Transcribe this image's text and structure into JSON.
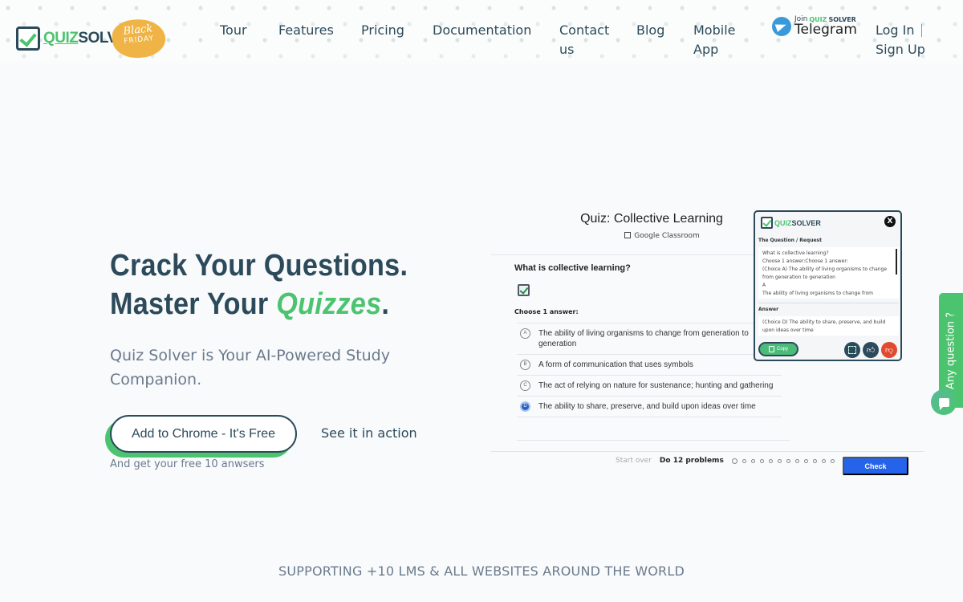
{
  "header": {
    "logo": {
      "part1": "QUIZ",
      "part2": "SOLVER"
    },
    "promo_badge": {
      "line1": "Black",
      "line2": "FRIDAY"
    },
    "nav": [
      {
        "label": "Tour"
      },
      {
        "label": "Features"
      },
      {
        "label": "Pricing"
      },
      {
        "label": "Documentation"
      },
      {
        "label": "Contact us"
      },
      {
        "label": "Blog"
      },
      {
        "label": "Mobile App"
      }
    ],
    "telegram": {
      "join": "Join",
      "brand1": "QUIZ",
      "brand2": "SOLVER",
      "label": "Telegram"
    },
    "auth": {
      "login": "Log In",
      "signup": "Sign Up"
    }
  },
  "hero": {
    "title_line1": "Crack Your Questions.",
    "title_line2_prefix": "Master Your ",
    "title_line2_accent": "Quizzes",
    "title_line2_suffix": ".",
    "subtitle": "Quiz Solver is Your AI-Powered Study Companion.",
    "cta_label": "Add to Chrome - It's Free",
    "secondary_link": "See it in action",
    "note": "And get your free 10 anwsers"
  },
  "quiz_demo": {
    "title": "Quiz: Collective Learning",
    "source": "Google Classroom",
    "question": "What is collective learning?",
    "instruction": "Choose 1 answer:",
    "choices": [
      {
        "letter": "A",
        "text": "The ability of living organisms to change from generation to generation",
        "selected": false
      },
      {
        "letter": "B",
        "text": "A form of communication that uses symbols",
        "selected": false
      },
      {
        "letter": "C",
        "text": "The act of relying on nature for sustenance; hunting and gathering",
        "selected": false
      },
      {
        "letter": "D",
        "text": "The ability to share, preserve, and build upon ideas over time",
        "selected": true
      }
    ],
    "footer": {
      "start_over": "Start over",
      "problems": "Do 12 problems",
      "progress_total": 12,
      "progress_current": 1,
      "check": "Check"
    }
  },
  "popup": {
    "logo": {
      "part1": "QUIZ",
      "part2": "SOLVER"
    },
    "close": "X",
    "question_label": "The Question / Request",
    "question_text": "What is collective learning?\nChoose 1 answer:Choose 1 answer:\n(Choice A)   The ability of living organisms to change from generation to generation\nA\nThe ability of living organisms to change from",
    "answer_label": "Answer",
    "answer_text": "(Choice D) The ability to share, preserve, and build upon ideas over time",
    "copy_label": "Copy"
  },
  "side_widget": {
    "label": "Any question ?"
  },
  "supporting": "SUPPORTING +10 LMS & ALL WEBSITES AROUND THE WORLD"
}
